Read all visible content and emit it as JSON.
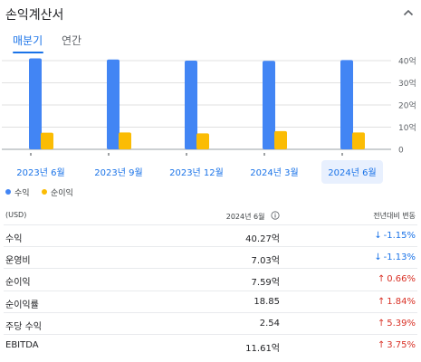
{
  "header": {
    "title": "손익계산서",
    "collapse_icon": "chevron-up-icon"
  },
  "tabs": [
    {
      "label": "매분기",
      "active": true
    },
    {
      "label": "연간",
      "active": false
    }
  ],
  "colors": {
    "revenue": "#4285f4",
    "net_income": "#fbbc04",
    "accent": "#1a73e8",
    "down": "#1a73e8",
    "up": "#d93025"
  },
  "chart_data": {
    "type": "bar",
    "categories": [
      "2023년 6월",
      "2023년 9월",
      "2023년 12월",
      "2024년 3월",
      "2024년 6월"
    ],
    "selected_category": "2024년 6월",
    "series": [
      {
        "name": "수익",
        "color": "#4285f4",
        "values": [
          41,
          40.5,
          40,
          39.9,
          40.27
        ]
      },
      {
        "name": "순이익",
        "color": "#fbbc04",
        "values": [
          7.5,
          7.6,
          7.2,
          8.2,
          7.59
        ]
      }
    ],
    "yticks": [
      "40억",
      "30억",
      "20억",
      "10억",
      "0"
    ],
    "ylim": [
      0,
      40
    ],
    "grid": true,
    "legend": "bottom-left"
  },
  "table": {
    "header": {
      "unit": "(USD)",
      "period": "2024년 6월",
      "change": "전년대비 변동"
    },
    "rows": [
      {
        "label": "수익",
        "value": "40.27억",
        "change": "-1.15%",
        "direction": "down"
      },
      {
        "label": "운영비",
        "value": "7.03억",
        "change": "-1.13%",
        "direction": "down"
      },
      {
        "label": "순이익",
        "value": "7.59억",
        "change": "0.66%",
        "direction": "up"
      },
      {
        "label": "순이익률",
        "value": "18.85",
        "change": "1.84%",
        "direction": "up"
      },
      {
        "label": "주당 수익",
        "value": "2.54",
        "change": "5.39%",
        "direction": "up"
      },
      {
        "label": "EBITDA",
        "value": "11.61억",
        "change": "3.75%",
        "direction": "up"
      }
    ]
  }
}
